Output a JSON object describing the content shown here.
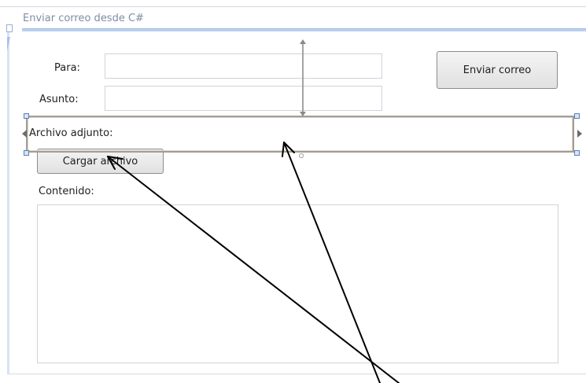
{
  "window": {
    "title": "Enviar correo desde C#"
  },
  "form": {
    "para_label": "Para:",
    "para_value": "",
    "asunto_label": "Asunto:",
    "asunto_value": "",
    "adjunto_label": "Archivo adjunto:",
    "contenido_label": "Contenido:",
    "contenido_value": ""
  },
  "buttons": {
    "enviar": "Enviar correo",
    "cargar": "Cargar archivo"
  },
  "icons": {
    "splitter": "grid-splitter-marker",
    "handles": "resize-handle",
    "annotation": "annotation-arrow"
  },
  "colors": {
    "title_bar": "#bcd0ef",
    "selection_border": "#a39d96",
    "annotation_arrow": "#000000"
  }
}
